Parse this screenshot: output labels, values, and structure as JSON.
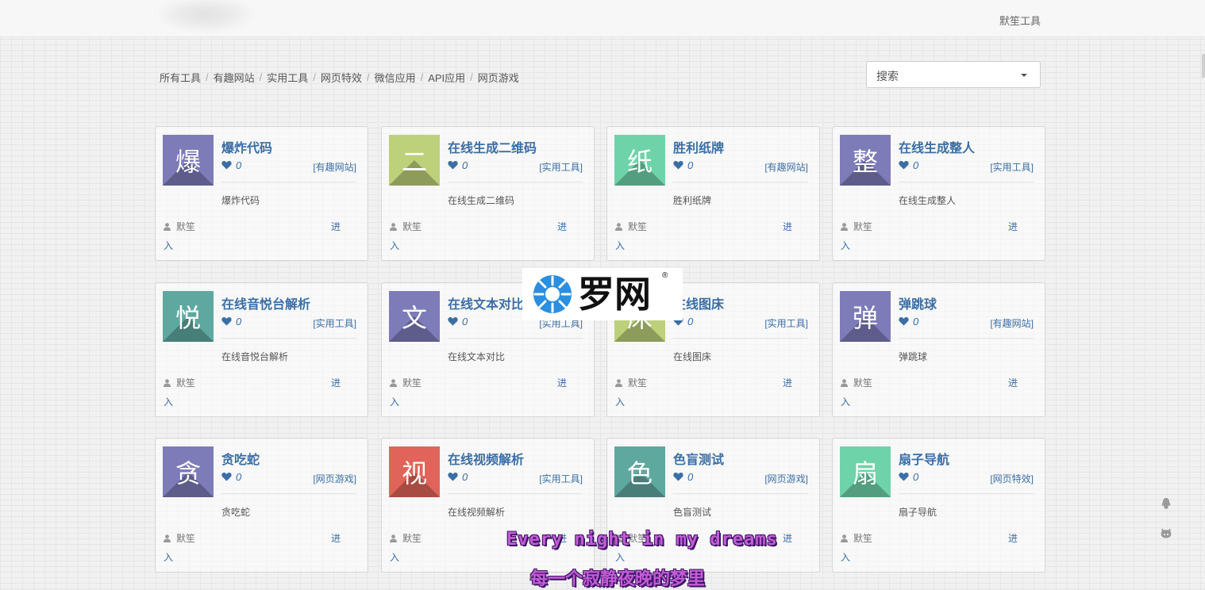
{
  "header": {
    "site_name": "默笙工具"
  },
  "breadcrumb": [
    "所有工具",
    "有趣网站",
    "实用工具",
    "网页特效",
    "微信应用",
    "API应用",
    "网页游戏"
  ],
  "search": {
    "value": "搜索"
  },
  "cards": [
    {
      "char": "爆",
      "title": "爆炸代码",
      "likes": "0",
      "category": "[有趣网站]",
      "desc": "爆炸代码",
      "author": "默笙",
      "enter_a": "进",
      "enter_b": "入",
      "color": "#7d7bb8"
    },
    {
      "char": "二",
      "title": "在线生成二维码",
      "likes": "0",
      "category": "[实用工具]",
      "desc": "在线生成二维码",
      "author": "默笙",
      "enter_a": "进",
      "enter_b": "入",
      "color": "#bdd07a"
    },
    {
      "char": "纸",
      "title": "胜利纸牌",
      "likes": "0",
      "category": "[有趣网站]",
      "desc": "胜利纸牌",
      "author": "默笙",
      "enter_a": "进",
      "enter_b": "入",
      "color": "#6fd3a9"
    },
    {
      "char": "整",
      "title": "在线生成整人",
      "likes": "0",
      "category": "[实用工具]",
      "desc": "在线生成整人",
      "author": "默笙",
      "enter_a": "进",
      "enter_b": "入",
      "color": "#7d7bb8"
    },
    {
      "char": "悦",
      "title": "在线音悦台解析",
      "likes": "0",
      "category": "[实用工具]",
      "desc": "在线音悦台解析",
      "author": "默笙",
      "enter_a": "进",
      "enter_b": "入",
      "color": "#5fa8a0"
    },
    {
      "char": "文",
      "title": "在线文本对比",
      "likes": "0",
      "category": "[实用工具]",
      "desc": "在线文本对比",
      "author": "默笙",
      "enter_a": "进",
      "enter_b": "入",
      "color": "#7d7bb8"
    },
    {
      "char": "床",
      "title": "在线图床",
      "likes": "0",
      "category": "[实用工具]",
      "desc": "在线图床",
      "author": "默笙",
      "enter_a": "进",
      "enter_b": "入",
      "color": "#bdd07a"
    },
    {
      "char": "弹",
      "title": "弹跳球",
      "likes": "0",
      "category": "[有趣网站]",
      "desc": "弹跳球",
      "author": "默笙",
      "enter_a": "进",
      "enter_b": "入",
      "color": "#7d7bb8"
    },
    {
      "char": "贪",
      "title": "贪吃蛇",
      "likes": "0",
      "category": "[网页游戏]",
      "desc": "贪吃蛇",
      "author": "默笙",
      "enter_a": "进",
      "enter_b": "入",
      "color": "#7d7bb8"
    },
    {
      "char": "视",
      "title": "在线视频解析",
      "likes": "0",
      "category": "[实用工具]",
      "desc": "在线视频解析",
      "author": "默笙",
      "enter_a": "进",
      "enter_b": "入",
      "color": "#e0645a"
    },
    {
      "char": "色",
      "title": "色盲测试",
      "likes": "0",
      "category": "[网页游戏]",
      "desc": "色盲测试",
      "author": "默笙",
      "enter_a": "进",
      "enter_b": "入",
      "color": "#5fa8a0"
    },
    {
      "char": "扇",
      "title": "扇子导航",
      "likes": "0",
      "category": "[网页特效]",
      "desc": "扇子导航",
      "author": "默笙",
      "enter_a": "进",
      "enter_b": "入",
      "color": "#6fd3a9"
    }
  ],
  "watermark": {
    "text": "罗网",
    "mark": "®"
  },
  "subtitles": {
    "en": "Every night in my dreams",
    "cn": "每一个寂静夜晚的梦里"
  },
  "side_icons": [
    "qq-icon",
    "github-icon"
  ],
  "colors": {
    "link": "#3a6ea5",
    "subtitle": "#c45cd6"
  }
}
